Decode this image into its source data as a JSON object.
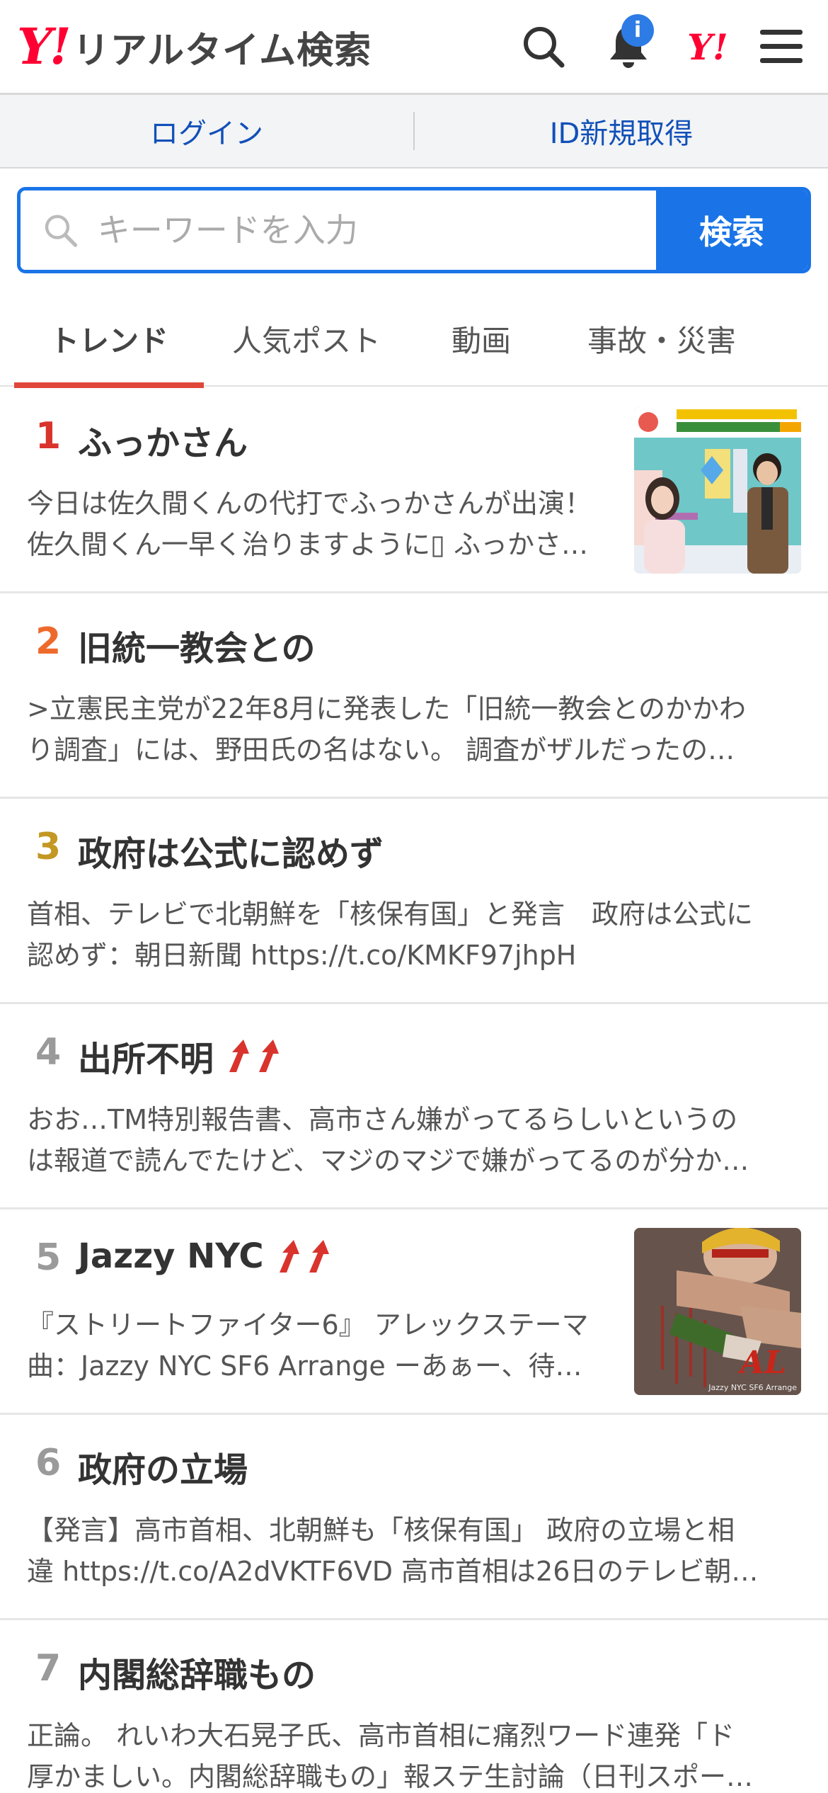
{
  "header": {
    "logo_mark": "Y!",
    "logo_text": "リアルタイム検索",
    "notification_badge": "i",
    "yjp_mark": "Y!",
    "icons": [
      "search-icon",
      "bell-icon",
      "yahoo-japan-icon",
      "menu-icon"
    ]
  },
  "auth": {
    "login_label": "ログイン",
    "register_label": "ID新規取得"
  },
  "search": {
    "placeholder": "キーワードを入力",
    "value": "",
    "button_label": "検索"
  },
  "tabs": [
    {
      "label": "トレンド",
      "active": true
    },
    {
      "label": "人気ポスト",
      "active": false
    },
    {
      "label": "動画",
      "active": false
    },
    {
      "label": "事故・災害",
      "active": false
    }
  ],
  "colors": {
    "accent_blue": "#1a74e8",
    "link_blue": "#1150b8",
    "tab_active_underline": "#e0463a",
    "rank1": "#d8342d",
    "rank2": "#ee6a2c",
    "rank3": "#c39823",
    "rank_other": "#9a9a9a",
    "trend_arrow": "#d8342d"
  },
  "trends": [
    {
      "rank": "1",
      "title": "ふっかさん",
      "rising": false,
      "desc_line1": "今日は佐久間くんの代打でふっかさんが出演！",
      "desc_line2": "佐久間くん一早く治りますように▯ ふっかさ…",
      "thumbnail": "tv-show-thumbnail"
    },
    {
      "rank": "2",
      "title": "旧統一教会との",
      "rising": false,
      "desc_line1": ">立憲民主党が22年8月に発表した「旧統一教会とのかかわ",
      "desc_line2": "り調査」には、野田氏の名はない。 調査がザルだったの…"
    },
    {
      "rank": "3",
      "title": "政府は公式に認めず",
      "rising": false,
      "desc_line1": "首相、テレビで北朝鮮を「核保有国」と発言　政府は公式に",
      "desc_line2": "認めず：朝日新聞 https://t.co/KMKF97jhpH"
    },
    {
      "rank": "4",
      "title": "出所不明",
      "rising": true,
      "desc_line1": "おお…TM特別報告書、高市さん嫌がってるらしいというの",
      "desc_line2": "は報道で読んでたけど、マジのマジで嫌がってるのが分か…"
    },
    {
      "rank": "5",
      "title": "Jazzy NYC",
      "rising": true,
      "desc_line1": "『ストリートファイター6』 アレックステーマ",
      "desc_line2": "曲：Jazzy NYC SF6 Arrange ーあぁー、待…",
      "thumbnail": "game-art-thumbnail",
      "thumbnail_caption": "Jazzy NYC SF6 Arrange"
    },
    {
      "rank": "6",
      "title": "政府の立場",
      "rising": false,
      "desc_line1": "【発言】高市首相、北朝鮮も「核保有国」 政府の立場と相",
      "desc_line2": "違 https://t.co/A2dVKTF6VD 高市首相は26日のテレビ朝…"
    },
    {
      "rank": "7",
      "title": "内閣総辞職もの",
      "rising": false,
      "desc_line1": "正論。 れいわ大石晃子氏、高市首相に痛烈ワード連発「ド",
      "desc_line2": "厚かましい。内閣総辞職もの」報ステ生討論（日刊スポー…"
    }
  ]
}
